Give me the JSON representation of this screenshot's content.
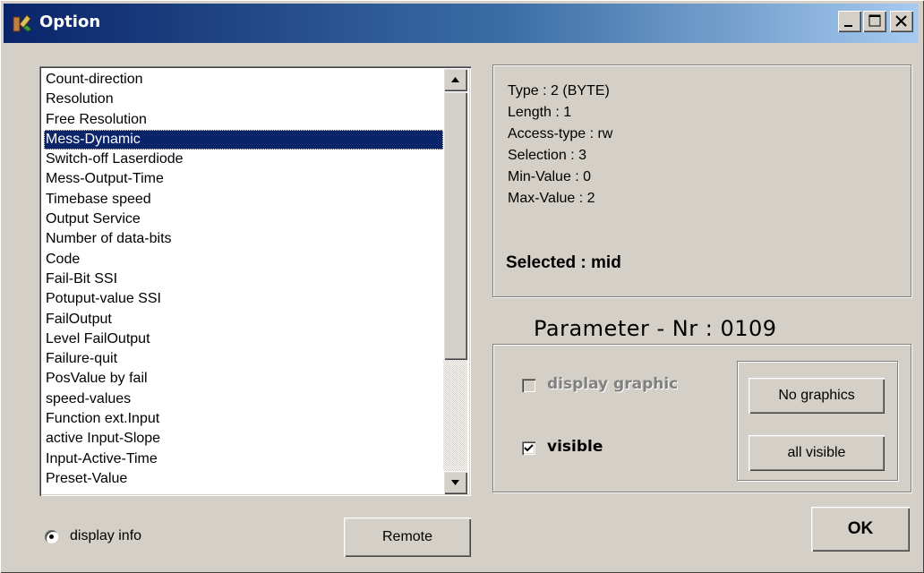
{
  "window": {
    "title": "Option",
    "icon": "app-icon"
  },
  "parameter_list": {
    "items": [
      "Count-direction",
      "Resolution",
      "Free Resolution",
      "Mess-Dynamic",
      "Switch-off Laserdiode",
      "Mess-Output-Time",
      "Timebase speed",
      "Output Service",
      "Number of data-bits",
      "Code",
      "Fail-Bit SSI",
      "Potuput-value SSI",
      "FailOutput",
      "Level FailOutput",
      "Failure-quit",
      "PosValue by fail",
      "speed-values",
      "Function ext.Input",
      "active Input-Slope",
      "Input-Active-Time",
      "Preset-Value"
    ],
    "selected_index": 3
  },
  "info": {
    "type": "Type : 2 (BYTE)",
    "length": "Length : 1",
    "access": "Access-type : rw",
    "selection": "Selection : 3",
    "min": "Min-Value : 0",
    "max": "Max-Value : 2",
    "selected": "Selected : mid"
  },
  "parameter_nr": "Parameter - Nr : 0109",
  "options": {
    "display_graphic": "display graphic",
    "display_graphic_checked": false,
    "display_graphic_enabled": false,
    "visible": "visible",
    "visible_checked": true,
    "no_graphics_button": "No graphics",
    "all_visible_button": "all visible"
  },
  "footer": {
    "display_info": "display info",
    "display_info_selected": true,
    "remote_button": "Remote",
    "ok_button": "OK"
  },
  "colors": {
    "titlebar_start": "#0a246a",
    "titlebar_end": "#a6caf0",
    "face": "#d4d0c8",
    "selection": "#0a246a",
    "disabled_text": "#808080"
  }
}
